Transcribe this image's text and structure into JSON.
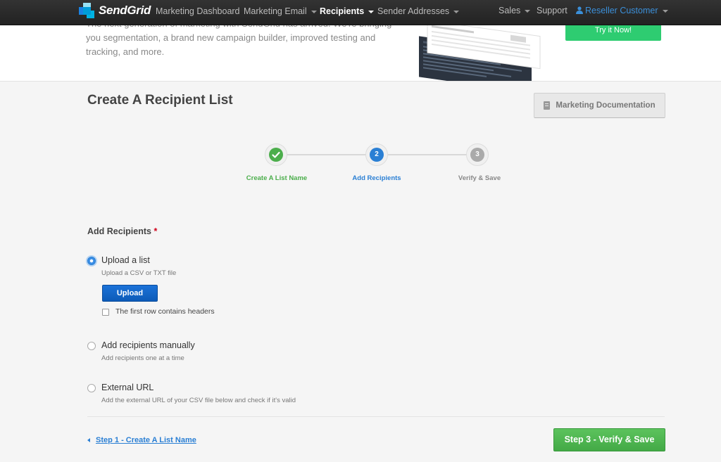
{
  "nav": {
    "logo_text": "SendGrid",
    "items": [
      {
        "label": "Marketing Dashboard"
      },
      {
        "label": "Marketing Email"
      },
      {
        "label": "Recipients"
      },
      {
        "label": "Sender Addresses"
      }
    ],
    "right": {
      "sales": "Sales",
      "support": "Support",
      "user": "Reseller Customer"
    }
  },
  "promo": {
    "text": "The next generation of marketing with SendGrid has arrived. We're bringing you segmentation, a brand new campaign builder, improved testing and tracking, and more.",
    "cta": "Try it Now!"
  },
  "header": {
    "title": "Create A Recipient List",
    "doc_button": "Marketing Documentation"
  },
  "steps": [
    {
      "number": "",
      "label": "Create A List Name",
      "state": "done"
    },
    {
      "number": "2",
      "label": "Add Recipients",
      "state": "active"
    },
    {
      "number": "3",
      "label": "Verify & Save",
      "state": "pending"
    }
  ],
  "form": {
    "section_label": "Add Recipients",
    "required_marker": "*",
    "options": [
      {
        "title": "Upload a list",
        "description": "Upload a CSV or TXT file",
        "selected": true
      },
      {
        "title": "Add recipients manually",
        "description": "Add recipients one at a time",
        "selected": false
      },
      {
        "title": "External URL",
        "description": "Add the external URL of your CSV file below and check if it's valid",
        "selected": false
      }
    ],
    "upload_button": "Upload",
    "headers_checkbox": "The first row contains headers"
  },
  "footer": {
    "back_link": "Step 1 - Create A List Name",
    "next_button": "Step 3 - Verify & Save"
  },
  "colors": {
    "nav_bg": "#262626",
    "done_green": "#4cae4c",
    "active_blue": "#2a7fd4",
    "pending_gray": "#aaaaaa",
    "cta_green": "#2ecc71",
    "next_green": "#4cb84e"
  }
}
